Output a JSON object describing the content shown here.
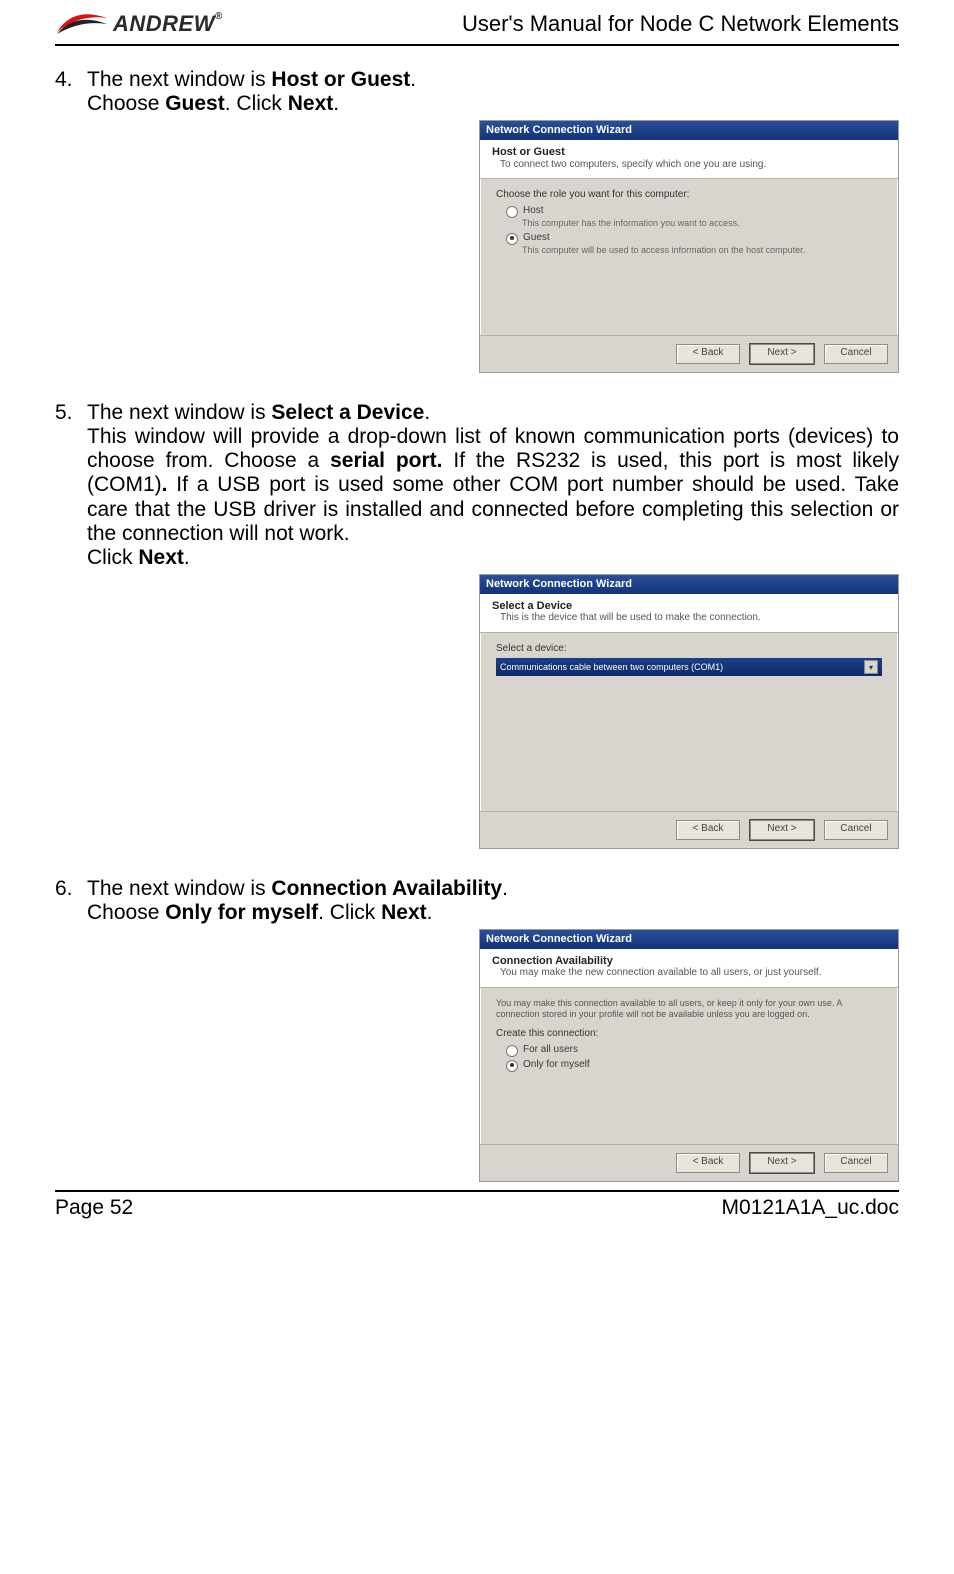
{
  "header": {
    "logo_text": "ANDREW",
    "doc_title": "User's Manual for Node C Network Elements"
  },
  "steps": {
    "s4": {
      "num": "4.",
      "line1_a": "The next window is ",
      "line1_b": "Host or Guest",
      "line1_c": ".",
      "line2_a": "Choose ",
      "line2_b": "Guest",
      "line2_c": ". Click ",
      "line2_d": "Next",
      "line2_e": "."
    },
    "s5": {
      "num": "5.",
      "line1_a": "The next window is ",
      "line1_b": "Select a Device",
      "line1_c": ".",
      "para_a": "This window will provide a drop-down list of known communication ports (devices) to choose from. Choose a ",
      "para_b": "serial port.",
      "para_c": " If the RS232 is used, this port is most likely (COM1)",
      "para_d": ".",
      "para_e": " If a USB port is used some other COM port number should be used. Take care that the USB driver is installed and connected before completing this selection or the connection will not work.",
      "line3_a": "Click ",
      "line3_b": "Next",
      "line3_c": "."
    },
    "s6": {
      "num": "6.",
      "line1_a": "The next window is ",
      "line1_b": "Connection Availability",
      "line1_c": ".",
      "line2_a": "Choose ",
      "line2_b": "Only for myself",
      "line2_c": ". Click ",
      "line2_d": "Next",
      "line2_e": "."
    }
  },
  "wiz1": {
    "title": "Network Connection Wizard",
    "head": "Host or Guest",
    "sub": "To connect two computers, specify which one you are using.",
    "prompt": "Choose the role you want for this computer:",
    "opt1": "Host",
    "opt1d": "This computer has the information you want to access.",
    "opt2": "Guest",
    "opt2d": "This computer will be used to access information on the host computer.",
    "back": "< Back",
    "next": "Next >",
    "cancel": "Cancel"
  },
  "wiz2": {
    "title": "Network Connection Wizard",
    "head": "Select a Device",
    "sub": "This is the device that will be used to make the connection.",
    "prompt": "Select a device:",
    "value": "Communications cable between two computers (COM1)",
    "back": "< Back",
    "next": "Next >",
    "cancel": "Cancel"
  },
  "wiz3": {
    "title": "Network Connection Wizard",
    "head": "Connection Availability",
    "sub": "You may make the new connection available to all users, or just yourself.",
    "note": "You may make this connection available to all users, or keep it only for your own use. A connection stored in your profile will not be available unless you are logged on.",
    "prompt": "Create this connection:",
    "opt1": "For all users",
    "opt2": "Only for myself",
    "back": "< Back",
    "next": "Next >",
    "cancel": "Cancel"
  },
  "footer": {
    "page": "Page 52",
    "doc": "M0121A1A_uc.doc"
  }
}
